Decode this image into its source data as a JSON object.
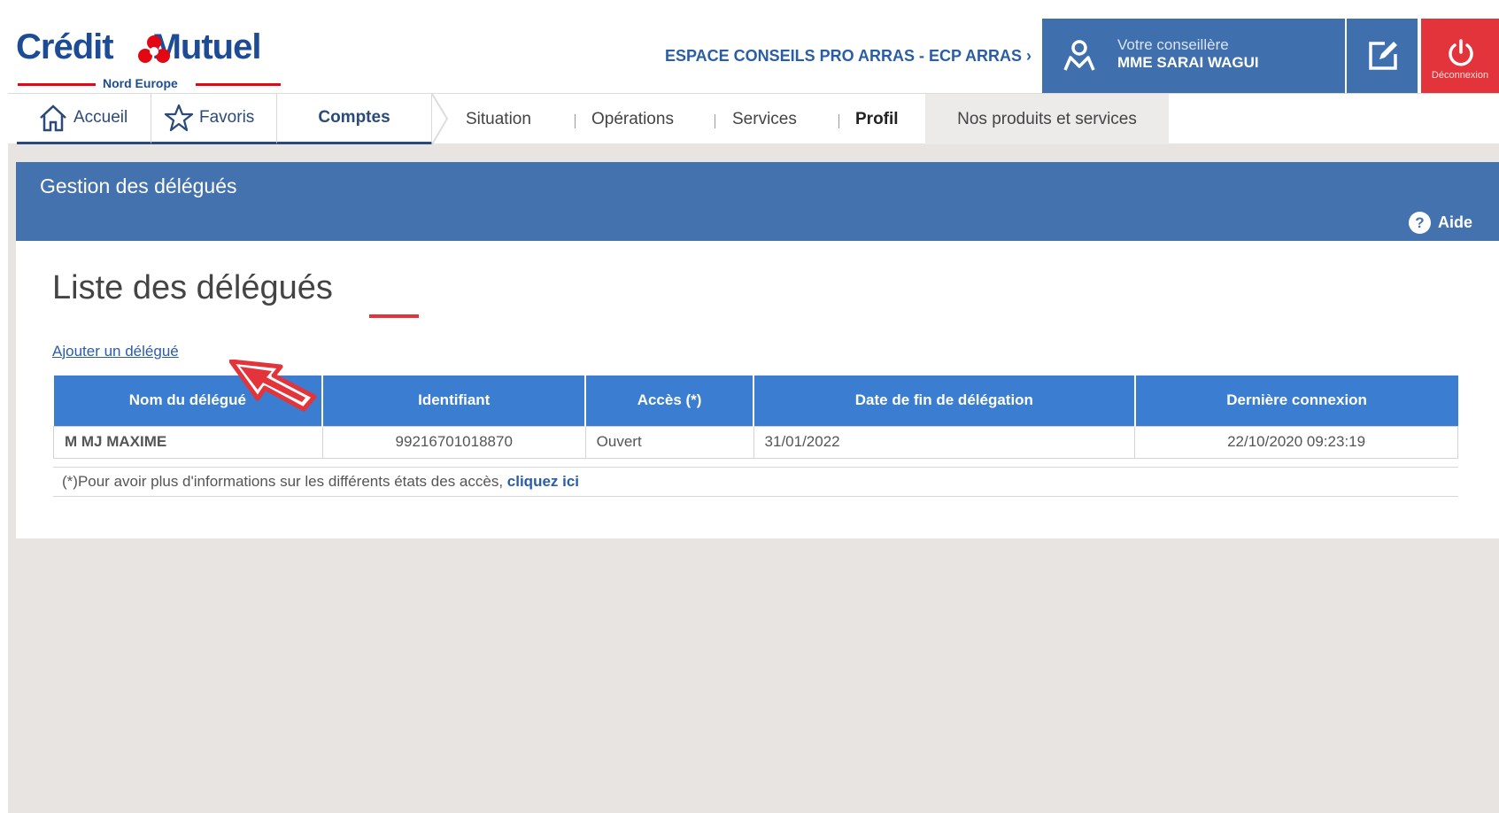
{
  "brand": {
    "name_part1": "Crédit",
    "name_part2": "Mutuel",
    "subtitle": "Nord Europe"
  },
  "header": {
    "espace_link": "ESPACE CONSEILS PRO ARRAS - ECP ARRAS ›",
    "advisor_label": "Votre conseillère",
    "advisor_name": "MME SARAI WAGUI",
    "logout_label": "Déconnexion"
  },
  "nav": {
    "accueil": "Accueil",
    "favoris": "Favoris",
    "comptes": "Comptes",
    "situation": "Situation",
    "operations": "Opérations",
    "services": "Services",
    "profil": "Profil",
    "produits": "Nos produits et services"
  },
  "banner": {
    "title": "Gestion des délégués",
    "help_label": "Aide"
  },
  "main": {
    "list_title": "Liste des délégués",
    "add_link": "Ajouter un délégué",
    "table": {
      "headers": [
        "Nom du délégué",
        "Identifiant",
        "Accès (*)",
        "Date de fin de délégation",
        "Dernière connexion"
      ],
      "rows": [
        [
          "M MJ MAXIME",
          "99216701018870",
          "Ouvert",
          "31/01/2022",
          "22/10/2020 09:23:19"
        ]
      ]
    },
    "footnote_text": "(*)Pour avoir plus d'informations sur les différents états des accès,",
    "footnote_link": "cliquez ici"
  },
  "colors": {
    "brand_blue": "#1d4c95",
    "banner_blue": "#4472ae",
    "table_header_blue": "#3b7dd0",
    "accent_red": "#e3333b"
  }
}
